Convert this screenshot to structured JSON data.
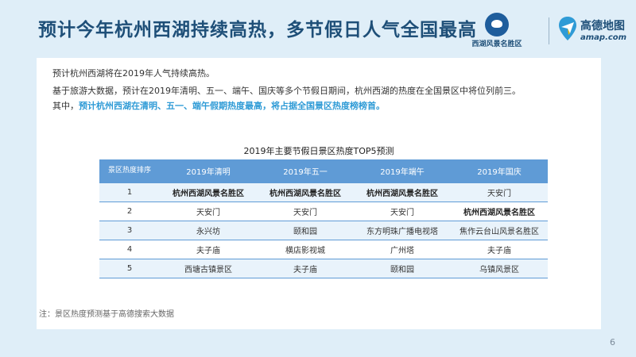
{
  "title": "预计今年杭州西湖持续高热，多节假日人气全国最高",
  "logos": {
    "westlake_text": "西湖风景名胜区",
    "amap_name": "高德地图",
    "amap_url": "amap.com"
  },
  "paragraphs": {
    "p1": "预计杭州西湖将在2019年人气持续高热。",
    "p2": "基于旅游大数据，预计在2019年清明、五一、端午、国庆等多个节假日期间，杭州西湖的热度在全国景区中将位列前三。",
    "p3_prefix": "其中，",
    "p3_highlight": "预计杭州西湖在清明、五一、端午假期热度最高，将占据全国景区热度榜榜首。"
  },
  "table": {
    "title": "2019年主要节假日景区热度TOP5预测",
    "rank_header": "景区热度排序",
    "columns": [
      "2019年清明",
      "2019年五一",
      "2019年端午",
      "2019年国庆"
    ],
    "rows": [
      {
        "rank": "1",
        "cells": [
          "杭州西湖风景名胜区",
          "杭州西湖风景名胜区",
          "杭州西湖风景名胜区",
          "天安门"
        ]
      },
      {
        "rank": "2",
        "cells": [
          "天安门",
          "天安门",
          "天安门",
          "杭州西湖风景名胜区"
        ]
      },
      {
        "rank": "3",
        "cells": [
          "永兴坊",
          "颐和园",
          "东方明珠广播电视塔",
          "焦作云台山风景名胜区"
        ]
      },
      {
        "rank": "4",
        "cells": [
          "夫子庙",
          "横店影视城",
          "广州塔",
          "夫子庙"
        ]
      },
      {
        "rank": "5",
        "cells": [
          "西塘古镇景区",
          "夫子庙",
          "颐和园",
          "乌镇风景区"
        ]
      }
    ]
  },
  "note": "注：景区热度预测基于高德搜索大数据",
  "page_number": "6",
  "colors": {
    "background": "#dfeef8",
    "title": "#1e4f78",
    "table_header": "#5f9bd6",
    "highlight": "#2f9bd6"
  },
  "icons": {
    "westlake_logo": "westlake-logo-icon",
    "amap_logo": "amap-logo-icon"
  }
}
